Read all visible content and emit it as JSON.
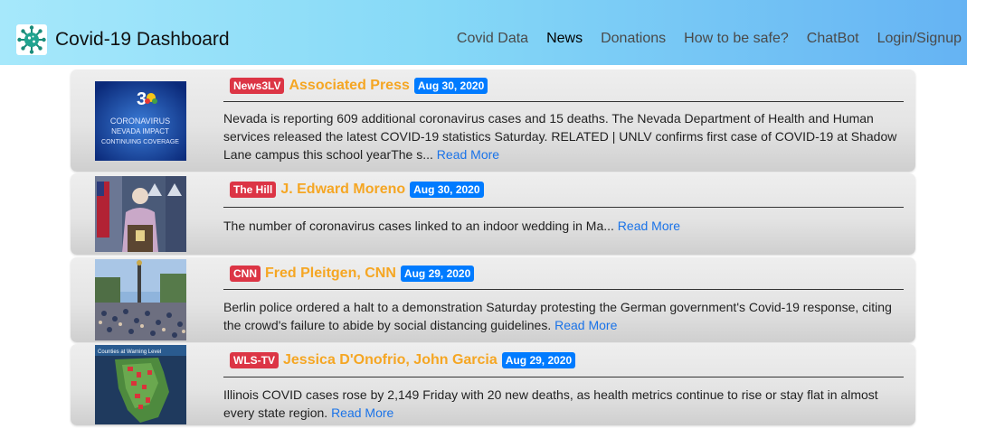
{
  "navbar": {
    "brand_label": "Covid-19 Dashboard",
    "brand_icon": "virus-icon",
    "links": [
      {
        "label": "Covid Data"
      },
      {
        "label": "News",
        "active": true
      },
      {
        "label": "Donations"
      },
      {
        "label": "How to be safe?"
      },
      {
        "label": "ChatBot"
      },
      {
        "label": "Login/Signup"
      }
    ]
  },
  "news": [
    {
      "source": "News3LV",
      "author": "Associated Press",
      "date": "Aug 30, 2020",
      "text": "Nevada is reporting 609 additional coronavirus cases and 15 deaths. The Nevada Department of Health and Human services released the latest COVID-19 statistics Saturday. RELATED | UNLV confirms first case of COVID-19 at Shadow Lane campus this school yearThe s...",
      "thumb_lines": [
        "CORONAVIRUS",
        "NEVADA IMPACT",
        "CONTINUING COVERAGE"
      ]
    },
    {
      "source": "The Hill",
      "author": "J. Edward Moreno",
      "date": "Aug 30, 2020",
      "text": "The number of coronavirus cases linked to an indoor wedding in Ma..."
    },
    {
      "source": "CNN",
      "author": "Fred Pleitgen, CNN",
      "date": "Aug 29, 2020",
      "text": "Berlin police ordered a halt to a demonstration Saturday protesting the German government's Covid-19 response, citing the crowd's failure to abide by social distancing guidelines."
    },
    {
      "source": "WLS-TV",
      "author": "Jessica D'Onofrio, John Garcia",
      "date": "Aug 29, 2020",
      "text": "Illinois COVID cases rose by 2,149 Friday with 20 new deaths, as health metrics continue to rise or stay flat in almost every state region.",
      "thumb_title": "Counties at Warning Level"
    }
  ],
  "read_more_label": "Read More",
  "colors": {
    "source_badge": "#dc3545",
    "author": "#f5a623",
    "date_badge": "#007bff",
    "link": "#1a73e8"
  }
}
